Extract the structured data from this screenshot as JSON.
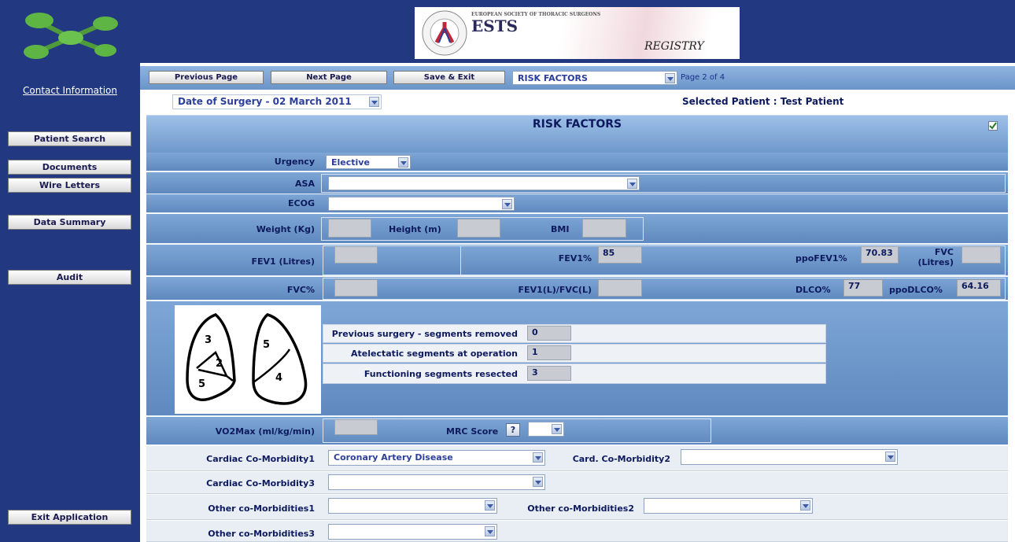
{
  "banner": {
    "logo_line1": "EUROPEAN SOCIETY OF THORACIC SURGEONS",
    "logo_title": "ESTS",
    "logo_subtitle": "REGISTRY"
  },
  "sidebar": {
    "contact_link": "Contact Information",
    "buttons": [
      "Patient Search",
      "Documents",
      "Wire Letters",
      "Data Summary",
      "Audit",
      "Exit Application"
    ]
  },
  "toolbar": {
    "previous": "Previous Page",
    "next": "Next Page",
    "save_exit": "Save & Exit",
    "section_select": "RISK FACTORS",
    "page_indicator": "Page 2 of 4"
  },
  "header": {
    "date_select": "Date of Surgery - 02 March 2011",
    "selected_patient": "Selected Patient : Test Patient"
  },
  "form": {
    "title": "RISK FACTORS",
    "urgency_label": "Urgency",
    "urgency_value": "Elective",
    "asa_label": "ASA",
    "ecog_label": "ECOG",
    "weight_label": "Weight (Kg)",
    "height_label": "Height (m)",
    "bmi_label": "BMI",
    "fev1_label": "FEV1 (Litres)",
    "fev1pct_label": "FEV1%",
    "fev1pct_value": "85",
    "ppofev1_label": "ppoFEV1%",
    "ppofev1_value": "70.83",
    "fvc_litres_label": "FVC (Litres)",
    "fvcpct_label": "FVC%",
    "ratio_label": "FEV1(L)/FVC(L)",
    "dlco_label": "DLCO%",
    "dlco_value": "77",
    "ppodlco_label": "ppoDLCO%",
    "ppodlco_value": "64.16",
    "lung_segments": [
      "3",
      "2",
      "5",
      "5",
      "4"
    ],
    "seg_prev_label": "Previous surgery - segments removed",
    "seg_prev_value": "0",
    "seg_atel_label": "Atelectatic segments at operation",
    "seg_atel_value": "1",
    "seg_func_label": "Functioning segments resected",
    "seg_func_value": "3",
    "vo2_label": "VO2Max (ml/kg/min)",
    "mrc_label": "MRC Score",
    "mrc_help": "?",
    "card1_label": "Cardiac Co-Morbidity1",
    "card1_value": "Coronary Artery Disease",
    "card2_label": "Card. Co-Morbidity2",
    "card3_label": "Cardiac Co-Morbidity3",
    "other1_label": "Other co-Morbidities1",
    "other2_label": "Other co-Morbidities2",
    "other3_label": "Other co-Morbidities3"
  }
}
